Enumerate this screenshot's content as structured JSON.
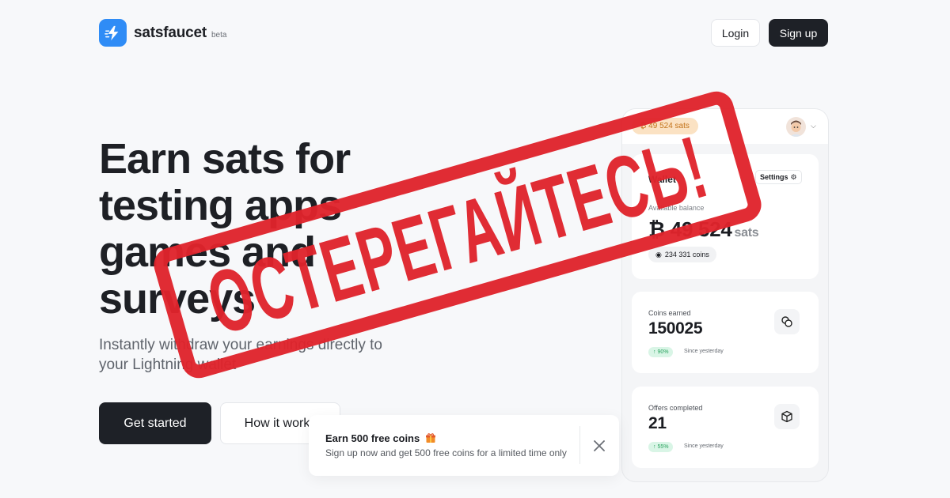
{
  "header": {
    "brand": "satsfaucet",
    "badge": "beta",
    "login_label": "Login",
    "signup_label": "Sign up"
  },
  "hero": {
    "title": "Earn sats for testing apps games and surveys",
    "subtitle": "Instantly withdraw your earnings directly to your Lightning wallet",
    "cta_primary": "Get started",
    "cta_secondary": "How it works"
  },
  "toast": {
    "title": "Earn 500 free coins",
    "text": "Sign up now and get 500 free coins for a limited time only",
    "gift_icon": "gift-icon",
    "close_icon": "close-icon"
  },
  "preview": {
    "balance_pill": "₿ 49 524 sats",
    "wallet": {
      "title": "Wallet",
      "settings_label": "Settings",
      "available_label": "Available balance",
      "balance": "₿ 49 524",
      "unit": "sats",
      "coins": "234 331 coins"
    },
    "coins_earned": {
      "label": "Coins earned",
      "value": "150025",
      "change": "↑ 90%",
      "since": "Since yesterday"
    },
    "offers_completed": {
      "label": "Offers completed",
      "value": "21",
      "change": "↑ 55%",
      "since": "Since yesterday"
    }
  },
  "stamp": {
    "text": "ОСТЕРЕГАЙТЕСЬ!"
  },
  "colors": {
    "brand_blue": "#2f8cf6",
    "dark": "#1e2127",
    "stamp_red": "#e0242c",
    "pill_orange_bg": "#fbe2c3",
    "positive_green": "#2aa35f"
  }
}
